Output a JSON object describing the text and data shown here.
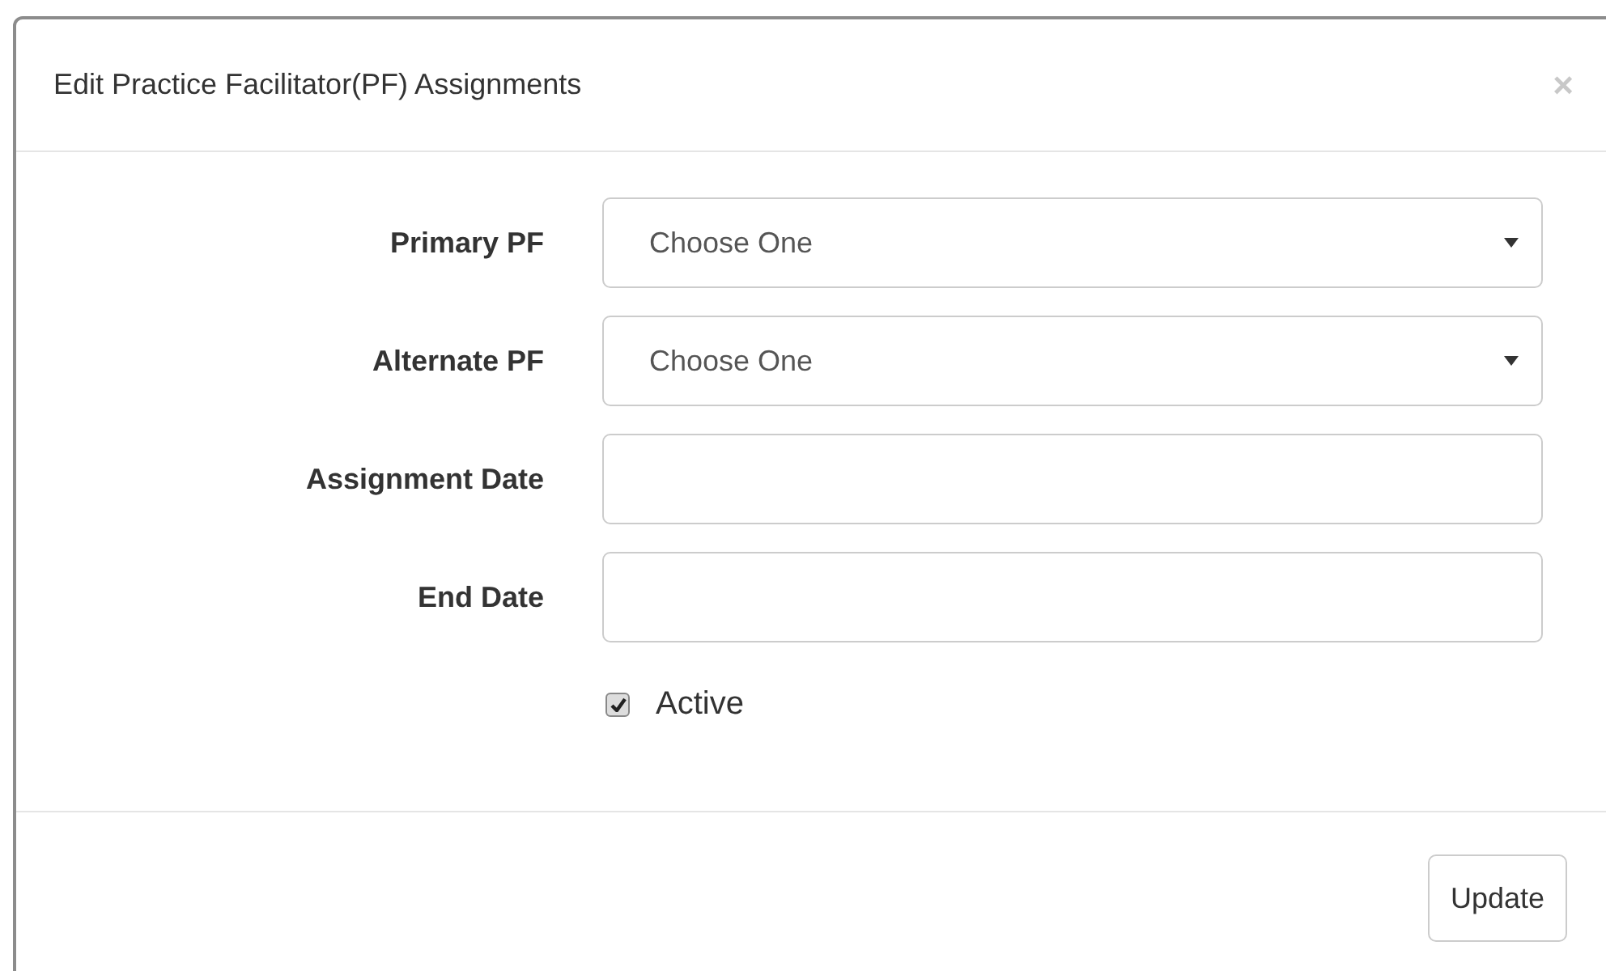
{
  "modal": {
    "title": "Edit Practice Facilitator(PF) Assignments",
    "close": "×"
  },
  "fields": [
    {
      "label": "Primary PF",
      "kind": "select",
      "value": "Choose One"
    },
    {
      "label": "Alternate PF",
      "kind": "select",
      "value": "Choose One"
    },
    {
      "label": "Assignment Date",
      "kind": "text"
    },
    {
      "label": "End Date",
      "kind": "text"
    }
  ],
  "active": {
    "label": "Active",
    "checked": true
  },
  "footer": {
    "button": "Update"
  }
}
